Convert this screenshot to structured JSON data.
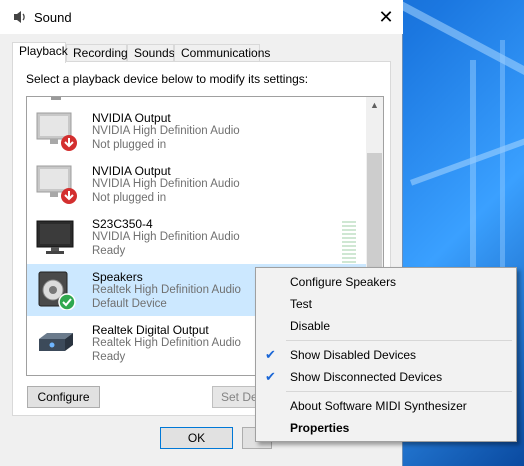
{
  "window": {
    "title": "Sound",
    "close_glyph": "✕"
  },
  "tabs": [
    {
      "label": "Playback"
    },
    {
      "label": "Recording"
    },
    {
      "label": "Sounds"
    },
    {
      "label": "Communications"
    }
  ],
  "instruction": "Select a playback device below to modify its settings:",
  "devices": [
    {
      "name": "NVIDIA Output",
      "driver": "NVIDIA High Definition Audio",
      "status": "Not plugged in"
    },
    {
      "name": "NVIDIA Output",
      "driver": "NVIDIA High Definition Audio",
      "status": "Not plugged in"
    },
    {
      "name": "S23C350-4",
      "driver": "NVIDIA High Definition Audio",
      "status": "Ready"
    },
    {
      "name": "Speakers",
      "driver": "Realtek High Definition Audio",
      "status": "Default Device"
    },
    {
      "name": "Realtek Digital Output",
      "driver": "Realtek High Definition Audio",
      "status": "Ready"
    }
  ],
  "buttons": {
    "configure": "Configure",
    "set_default": "Set De",
    "ok": "OK"
  },
  "context_menu": {
    "items": [
      {
        "label": "Configure Speakers",
        "checked": false
      },
      {
        "label": "Test",
        "checked": false
      },
      {
        "label": "Disable",
        "checked": false
      },
      {
        "label": "Show Disabled Devices",
        "checked": true
      },
      {
        "label": "Show Disconnected Devices",
        "checked": true
      },
      {
        "label": "About Software MIDI Synthesizer",
        "checked": false
      },
      {
        "label": "Properties",
        "checked": false
      }
    ],
    "check_glyph": "✔"
  },
  "colors": {
    "selection": "#cce8ff",
    "accent": "#0078d7",
    "desktop": "#1b77e0"
  }
}
